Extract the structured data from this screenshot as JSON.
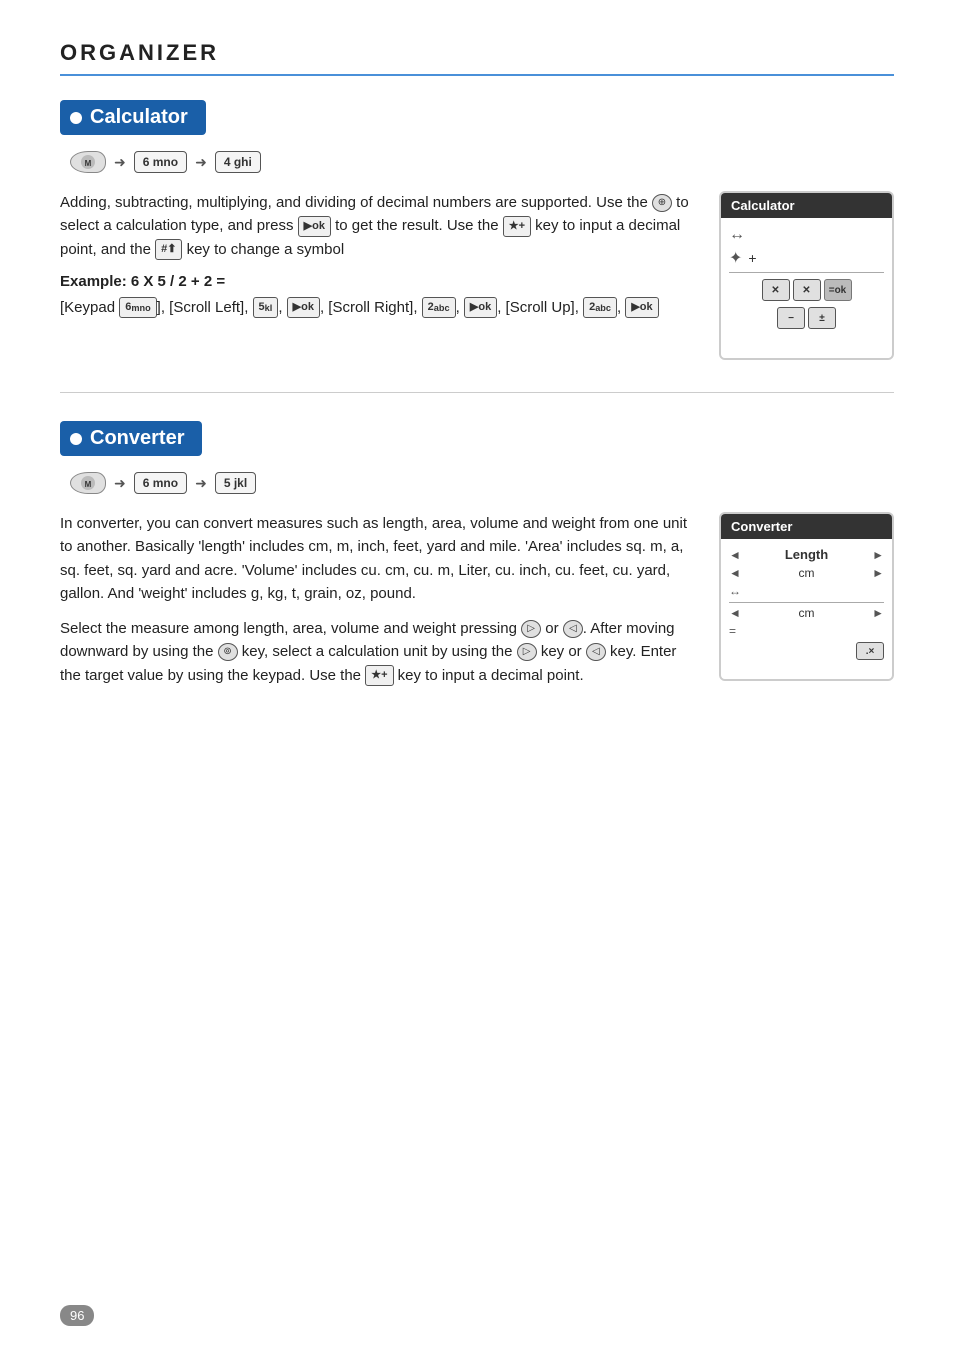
{
  "page": {
    "title": "ORGANIZER",
    "number": "96"
  },
  "calculator": {
    "section_title": "Calculator",
    "nav": {
      "menu_key": "MENU",
      "step1": "6 mno",
      "step2": "4 ghi"
    },
    "body_text": "Adding, subtracting, multiplying, and dividing of decimal numbers are supported. Use the  to select a calculation type, and press  to get the result. Use the  key to input a decimal point, and the  key to change a symbol",
    "example_label": "Example: 6 X 5 / 2 + 2 =",
    "example_detail": "[Keypad 6mno], [Scroll Left], [5 kl], [ok], [Scroll Right], [2 abc], [ok], [Scroll Up], [2 abc], [ok]",
    "panel_title": "Calculator",
    "panel": {
      "row1_icon": "↔",
      "row2_icon": "+",
      "operator": "+",
      "buttons": [
        "✕",
        "✕",
        "✕",
        "=ok",
        "−",
        "±"
      ]
    }
  },
  "converter": {
    "section_title": "Converter",
    "nav": {
      "menu_key": "MENU",
      "step1": "6 mno",
      "step2": "5 jkl"
    },
    "body_text1": "In converter, you can convert measures such as length, area, volume and weight from one unit to another. Basically 'length' includes cm, m, inch, feet, yard and mile. 'Area' includes sq. m, a, sq. feet, sq. yard and acre. 'Volume' includes cu. cm, cu. m, Liter, cu. inch, cu. feet, cu. yard, gallon. And 'weight' includes g, kg, t, grain, oz, pound.",
    "body_text2": "Select the measure among length, area, volume and weight pressing  or . After moving downward by using the  key, select a calculation unit by using the  key or  key. Enter the target value by using the keypad. Use the  key to input a decimal point.",
    "panel_title": "Converter",
    "panel": {
      "row1_left": "◄",
      "row1_label": "Length",
      "row1_right": "►",
      "row2_left": "◄",
      "row2_value": "cm",
      "row2_right": "►",
      "row3_icon": "↔",
      "row4_left": "◄",
      "row4_value": "cm",
      "row4_right": "►",
      "row5_icon": "=",
      "dot_btn": ".×"
    }
  }
}
